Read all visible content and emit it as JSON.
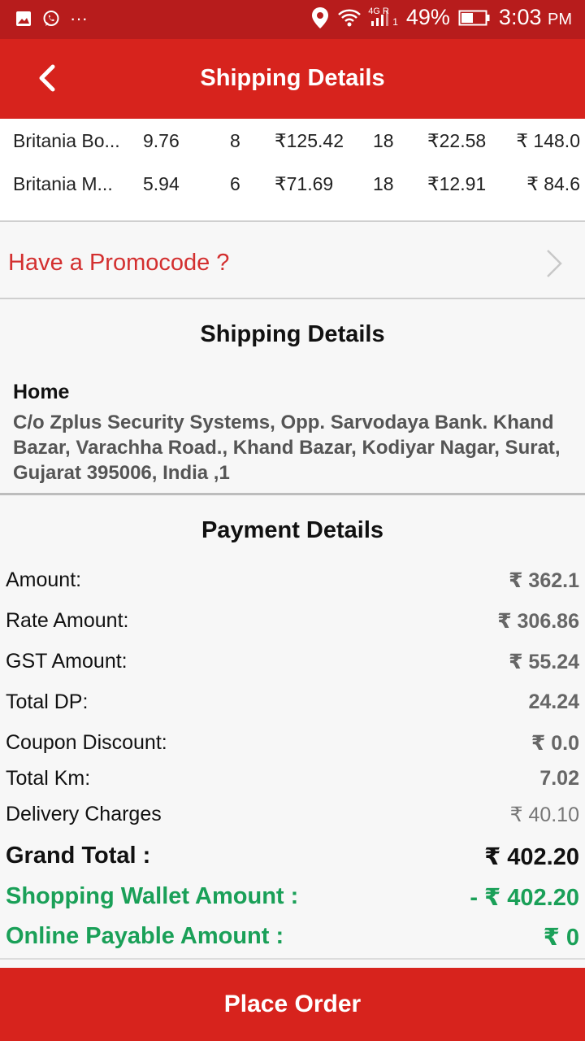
{
  "status_bar": {
    "battery": "49%",
    "time": "3:03",
    "ampm": "PM",
    "network": "4G R",
    "sim": "1",
    "dots": "···"
  },
  "header": {
    "title": "Shipping Details"
  },
  "items": [
    {
      "name": "Britania Bo...",
      "weight": "9.76",
      "qty": "8",
      "rate": "₹125.42",
      "gst": "18",
      "gst_amount": "₹22.58",
      "total": "₹ 148.0"
    },
    {
      "name": "Britania M...",
      "weight": "5.94",
      "qty": "6",
      "rate": "₹71.69",
      "gst": "18",
      "gst_amount": "₹12.91",
      "total": "₹ 84.6"
    }
  ],
  "promo": {
    "label": "Have a Promocode ?"
  },
  "shipping": {
    "title": "Shipping Details",
    "address_type": "Home",
    "address": "C/o Zplus Security Systems, Opp. Sarvodaya Bank. Khand Bazar, Varachha Road., Khand Bazar, Kodiyar Nagar, Surat, Gujarat 395006, India ,1"
  },
  "payment": {
    "title": "Payment Details",
    "rows": [
      {
        "label": "Amount:",
        "value": "₹ 362.1"
      },
      {
        "label": "Rate Amount:",
        "value": "₹ 306.86"
      },
      {
        "label": "GST Amount:",
        "value": "₹ 55.24"
      },
      {
        "label": "Total DP:",
        "value": "24.24"
      },
      {
        "label": "Coupon Discount:",
        "value": "₹ 0.0"
      },
      {
        "label": "Total Km:",
        "value": "7.02"
      },
      {
        "label": "Delivery Charges",
        "value": "₹ 40.10"
      }
    ],
    "grand_total": {
      "label": "Grand Total :",
      "value": "₹ 402.20"
    },
    "wallet": {
      "label": "Shopping Wallet Amount :",
      "value": "- ₹ 402.20"
    },
    "online": {
      "label": "Online Payable Amount :",
      "value": "₹ 0"
    }
  },
  "footer": {
    "place_order": "Place Order"
  },
  "colors": {
    "status_bar": "#b71c1c",
    "primary": "#d7231d",
    "green": "#1aa058"
  }
}
